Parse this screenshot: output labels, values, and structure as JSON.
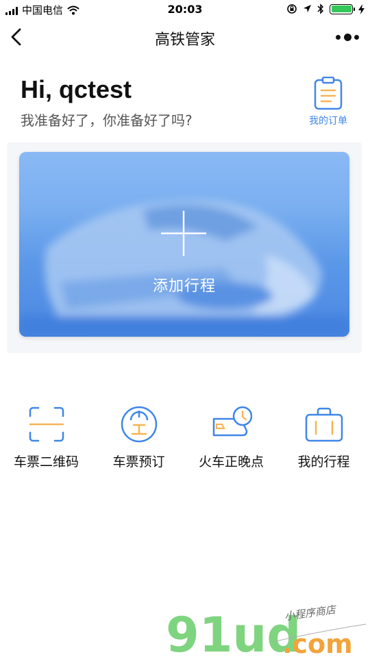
{
  "status_bar": {
    "carrier": "中国电信",
    "time": "20:03",
    "battery_level": 1.0,
    "icons": [
      "signal-icon",
      "wifi-icon",
      "lock-rotation-icon",
      "location-icon",
      "bluetooth-icon",
      "battery-icon",
      "charging-icon"
    ]
  },
  "nav": {
    "title": "高铁管家",
    "back_icon": "chevron-left-icon",
    "more_icon": "more-dots-icon"
  },
  "greeting": {
    "title": "Hi, qctest",
    "subtitle": "我准备好了，你准备好了吗?"
  },
  "orders": {
    "label": "我的订单",
    "icon": "clipboard-icon"
  },
  "trip_card": {
    "label": "添加行程",
    "icon": "plus-icon"
  },
  "features": [
    {
      "label": "车票二维码",
      "icon": "scan-frame-icon"
    },
    {
      "label": "车票预订",
      "icon": "railway-logo-icon"
    },
    {
      "label": "火车正晚点",
      "icon": "train-clock-icon"
    },
    {
      "label": "我的行程",
      "icon": "suitcase-icon"
    }
  ],
  "watermark": {
    "brand": "91ud",
    "domain": ".com",
    "tagline": "小程序商店"
  },
  "colors": {
    "accent_blue": "#3f86e8",
    "accent_orange": "#f5b454",
    "watermark_green": "#7fd47f",
    "watermark_orange": "#f2a33a"
  }
}
